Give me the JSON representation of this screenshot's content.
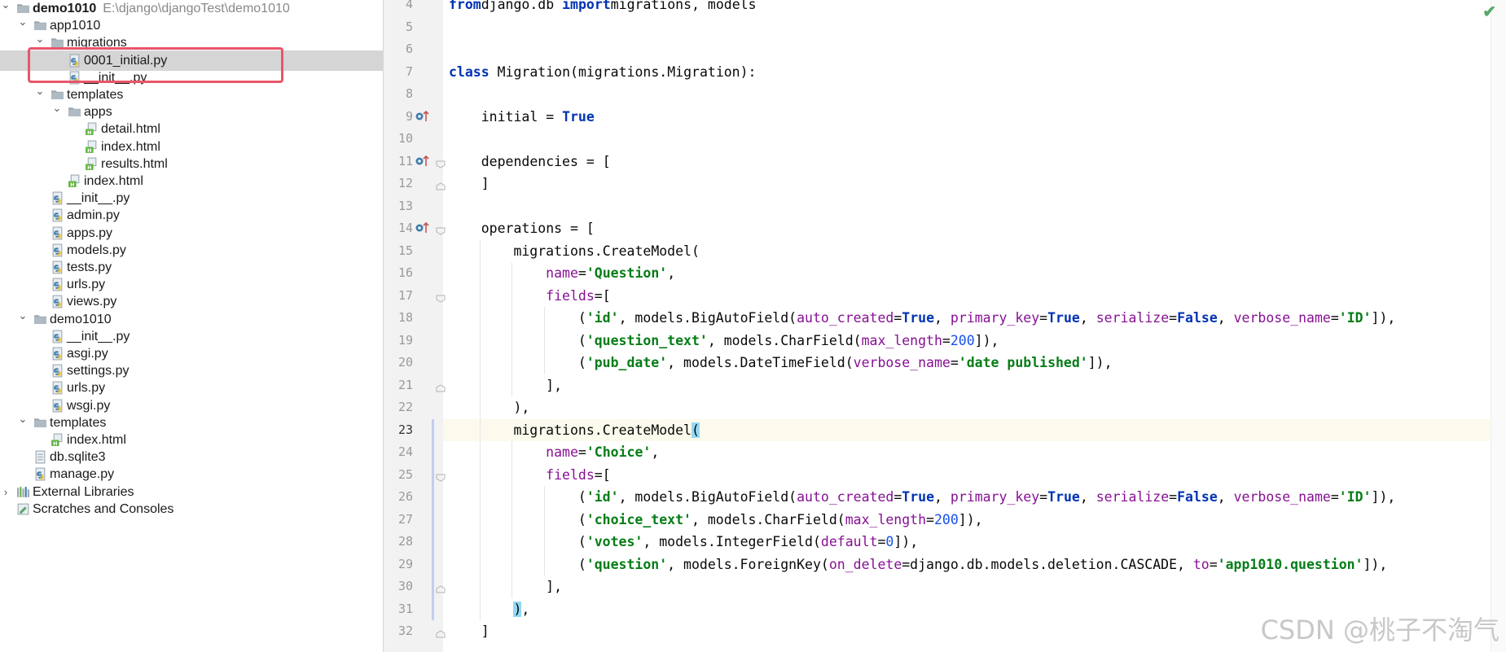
{
  "tree": {
    "items": [
      {
        "label": "demo1010",
        "path": "E:\\django\\djangoTest\\demo1010",
        "kind": "folder",
        "arrow": "down",
        "bold": true,
        "depth": 0
      },
      {
        "label": "app1010",
        "kind": "folder",
        "arrow": "down",
        "depth": 1
      },
      {
        "label": "migrations",
        "kind": "folder",
        "arrow": "down",
        "depth": 2
      },
      {
        "label": "0001_initial.py",
        "kind": "py",
        "depth": 3,
        "selected": true
      },
      {
        "label": "__init__.py",
        "kind": "py",
        "depth": 3
      },
      {
        "label": "templates",
        "kind": "folder",
        "arrow": "down",
        "depth": 2
      },
      {
        "label": "apps",
        "kind": "folder",
        "arrow": "down",
        "depth": 3
      },
      {
        "label": "detail.html",
        "kind": "html",
        "depth": 4
      },
      {
        "label": "index.html",
        "kind": "html",
        "depth": 4
      },
      {
        "label": "results.html",
        "kind": "html",
        "depth": 4
      },
      {
        "label": "index.html",
        "kind": "html",
        "depth": 3
      },
      {
        "label": "__init__.py",
        "kind": "py",
        "depth": 2
      },
      {
        "label": "admin.py",
        "kind": "py",
        "depth": 2
      },
      {
        "label": "apps.py",
        "kind": "py",
        "depth": 2
      },
      {
        "label": "models.py",
        "kind": "py",
        "depth": 2
      },
      {
        "label": "tests.py",
        "kind": "py",
        "depth": 2
      },
      {
        "label": "urls.py",
        "kind": "py",
        "depth": 2
      },
      {
        "label": "views.py",
        "kind": "py",
        "depth": 2
      },
      {
        "label": "demo1010",
        "kind": "folder",
        "arrow": "down",
        "depth": 1
      },
      {
        "label": "__init__.py",
        "kind": "py",
        "depth": 2
      },
      {
        "label": "asgi.py",
        "kind": "py",
        "depth": 2
      },
      {
        "label": "settings.py",
        "kind": "py",
        "depth": 2
      },
      {
        "label": "urls.py",
        "kind": "py",
        "depth": 2
      },
      {
        "label": "wsgi.py",
        "kind": "py",
        "depth": 2
      },
      {
        "label": "templates",
        "kind": "folder",
        "arrow": "down",
        "depth": 1
      },
      {
        "label": "index.html",
        "kind": "html",
        "depth": 2
      },
      {
        "label": "db.sqlite3",
        "kind": "db",
        "depth": 1
      },
      {
        "label": "manage.py",
        "kind": "py",
        "depth": 1
      },
      {
        "label": "External Libraries",
        "kind": "lib",
        "arrow": "right",
        "depth": 0
      },
      {
        "label": "Scratches and Consoles",
        "kind": "scratch",
        "depth": 0
      }
    ]
  },
  "editor": {
    "current_line": 23,
    "lines": [
      {
        "n": 4,
        "indent": 0,
        "tokens": [
          [
            "kw",
            "from"
          ],
          [
            "",
            "django.db "
          ],
          [
            "kw",
            "import"
          ],
          [
            "",
            "migrations, models"
          ]
        ]
      },
      {
        "n": 5,
        "indent": 0,
        "tokens": []
      },
      {
        "n": 6,
        "indent": 0,
        "tokens": []
      },
      {
        "n": 7,
        "indent": 0,
        "tokens": [
          [
            "kw",
            "class"
          ],
          [
            "",
            " Migration(migrations.Migration):"
          ]
        ]
      },
      {
        "n": 8,
        "indent": 0,
        "tokens": []
      },
      {
        "n": 9,
        "indent": 1,
        "marker": true,
        "tokens": [
          [
            "",
            "initial = "
          ],
          [
            "kw",
            "True"
          ]
        ]
      },
      {
        "n": 10,
        "indent": 0,
        "tokens": []
      },
      {
        "n": 11,
        "indent": 1,
        "marker": true,
        "fold": "open",
        "tokens": [
          [
            "",
            "dependencies = ["
          ]
        ]
      },
      {
        "n": 12,
        "indent": 1,
        "fold": "close",
        "tokens": [
          [
            "",
            "]"
          ]
        ]
      },
      {
        "n": 13,
        "indent": 0,
        "tokens": []
      },
      {
        "n": 14,
        "indent": 1,
        "marker": true,
        "fold": "open",
        "tokens": [
          [
            "",
            "operations = ["
          ]
        ]
      },
      {
        "n": 15,
        "indent": 2,
        "tokens": [
          [
            "",
            "migrations.CreateModel("
          ]
        ]
      },
      {
        "n": 16,
        "indent": 3,
        "tokens": [
          [
            "prm",
            "name"
          ],
          [
            "",
            "="
          ],
          [
            "str",
            "'Question'"
          ],
          [
            "",
            ","
          ]
        ]
      },
      {
        "n": 17,
        "indent": 3,
        "fold": "open",
        "tokens": [
          [
            "prm",
            "fields"
          ],
          [
            "",
            "=["
          ]
        ]
      },
      {
        "n": 18,
        "indent": 4,
        "tokens": [
          [
            "",
            "("
          ],
          [
            "str",
            "'id'"
          ],
          [
            "",
            ", models.BigAutoField("
          ],
          [
            "prm",
            "auto_created"
          ],
          [
            "",
            "="
          ],
          [
            "kw",
            "True"
          ],
          [
            "",
            ", "
          ],
          [
            "prm",
            "primary_key"
          ],
          [
            "",
            "="
          ],
          [
            "kw",
            "True"
          ],
          [
            "",
            ", "
          ],
          [
            "prm",
            "serialize"
          ],
          [
            "",
            "="
          ],
          [
            "kw",
            "False"
          ],
          [
            "",
            ", "
          ],
          [
            "prm",
            "verbose_name"
          ],
          [
            "",
            "="
          ],
          [
            "str",
            "'ID'"
          ],
          [
            "",
            "]),"
          ]
        ]
      },
      {
        "n": 19,
        "indent": 4,
        "tokens": [
          [
            "",
            "("
          ],
          [
            "str",
            "'question_text'"
          ],
          [
            "",
            ", models.CharField("
          ],
          [
            "prm",
            "max_length"
          ],
          [
            "",
            "="
          ],
          [
            "num",
            "200"
          ],
          [
            "",
            "]),"
          ]
        ]
      },
      {
        "n": 20,
        "indent": 4,
        "tokens": [
          [
            "",
            "("
          ],
          [
            "str",
            "'pub_date'"
          ],
          [
            "",
            ", models.DateTimeField("
          ],
          [
            "prm",
            "verbose_name"
          ],
          [
            "",
            "="
          ],
          [
            "str",
            "'date published'"
          ],
          [
            "",
            "]),"
          ]
        ]
      },
      {
        "n": 21,
        "indent": 3,
        "fold": "close",
        "tokens": [
          [
            "",
            "],"
          ]
        ]
      },
      {
        "n": 22,
        "indent": 2,
        "tokens": [
          [
            "",
            "),"
          ]
        ]
      },
      {
        "n": 23,
        "indent": 2,
        "tokens": [
          [
            "",
            "migrations.CreateModel"
          ],
          [
            "bm",
            "("
          ]
        ]
      },
      {
        "n": 24,
        "indent": 3,
        "tokens": [
          [
            "prm",
            "name"
          ],
          [
            "",
            "="
          ],
          [
            "str",
            "'Choice'"
          ],
          [
            "",
            ","
          ]
        ]
      },
      {
        "n": 25,
        "indent": 3,
        "fold": "open",
        "tokens": [
          [
            "prm",
            "fields"
          ],
          [
            "",
            "=["
          ]
        ]
      },
      {
        "n": 26,
        "indent": 4,
        "tokens": [
          [
            "",
            "("
          ],
          [
            "str",
            "'id'"
          ],
          [
            "",
            ", models.BigAutoField("
          ],
          [
            "prm",
            "auto_created"
          ],
          [
            "",
            "="
          ],
          [
            "kw",
            "True"
          ],
          [
            "",
            ", "
          ],
          [
            "prm",
            "primary_key"
          ],
          [
            "",
            "="
          ],
          [
            "kw",
            "True"
          ],
          [
            "",
            ", "
          ],
          [
            "prm",
            "serialize"
          ],
          [
            "",
            "="
          ],
          [
            "kw",
            "False"
          ],
          [
            "",
            ", "
          ],
          [
            "prm",
            "verbose_name"
          ],
          [
            "",
            "="
          ],
          [
            "str",
            "'ID'"
          ],
          [
            "",
            "]),"
          ]
        ]
      },
      {
        "n": 27,
        "indent": 4,
        "tokens": [
          [
            "",
            "("
          ],
          [
            "str",
            "'choice_text'"
          ],
          [
            "",
            ", models.CharField("
          ],
          [
            "prm",
            "max_length"
          ],
          [
            "",
            "="
          ],
          [
            "num",
            "200"
          ],
          [
            "",
            "]),"
          ]
        ]
      },
      {
        "n": 28,
        "indent": 4,
        "tokens": [
          [
            "",
            "("
          ],
          [
            "str",
            "'votes'"
          ],
          [
            "",
            ", models.IntegerField("
          ],
          [
            "prm",
            "default"
          ],
          [
            "",
            "="
          ],
          [
            "num",
            "0"
          ],
          [
            "",
            "]),"
          ]
        ]
      },
      {
        "n": 29,
        "indent": 4,
        "tokens": [
          [
            "",
            "("
          ],
          [
            "str",
            "'question'"
          ],
          [
            "",
            ", models.ForeignKey("
          ],
          [
            "prm",
            "on_delete"
          ],
          [
            "",
            "=django.db.models.deletion.CASCADE, "
          ],
          [
            "prm",
            "to"
          ],
          [
            "",
            "="
          ],
          [
            "str",
            "'app1010.question'"
          ],
          [
            "",
            "]),"
          ]
        ]
      },
      {
        "n": 30,
        "indent": 3,
        "fold": "close",
        "tokens": [
          [
            "",
            "],"
          ]
        ]
      },
      {
        "n": 31,
        "indent": 2,
        "tokens": [
          [
            "bm",
            ")"
          ],
          [
            "",
            ","
          ]
        ]
      },
      {
        "n": 32,
        "indent": 1,
        "fold": "close",
        "tokens": [
          [
            "",
            "]"
          ]
        ]
      }
    ]
  },
  "watermark": "CSDN @桃子不淘气",
  "status_check": "✔",
  "colors": {
    "keyword": "#0033b3",
    "string": "#067d17",
    "param": "#871094",
    "number": "#1750eb",
    "selection": "#d5d5d5",
    "highlight_box": "#e8566b"
  }
}
